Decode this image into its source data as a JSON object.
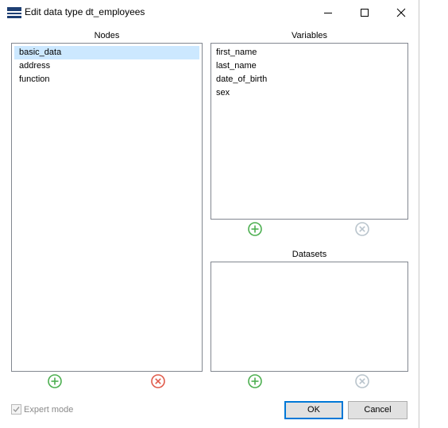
{
  "window": {
    "title": "Edit data type dt_employees",
    "accent": "#1e3f73"
  },
  "nodes": {
    "label": "Nodes",
    "items": [
      "basic_data",
      "address",
      "function"
    ],
    "selected": "basic_data"
  },
  "variables": {
    "label": "Variables",
    "items": [
      "first_name",
      "last_name",
      "date_of_birth",
      "sex"
    ]
  },
  "datasets": {
    "label": "Datasets",
    "items": []
  },
  "actions": {
    "add_icon": "plus-circle-icon",
    "remove_icon": "x-circle-icon",
    "add_color": "#4caf50",
    "remove_active_color": "#e05a4a",
    "remove_disabled_color": "#b9c4cc"
  },
  "footer": {
    "expert_mode_label": "Expert mode",
    "expert_mode_checked": true,
    "ok_label": "OK",
    "cancel_label": "Cancel"
  }
}
